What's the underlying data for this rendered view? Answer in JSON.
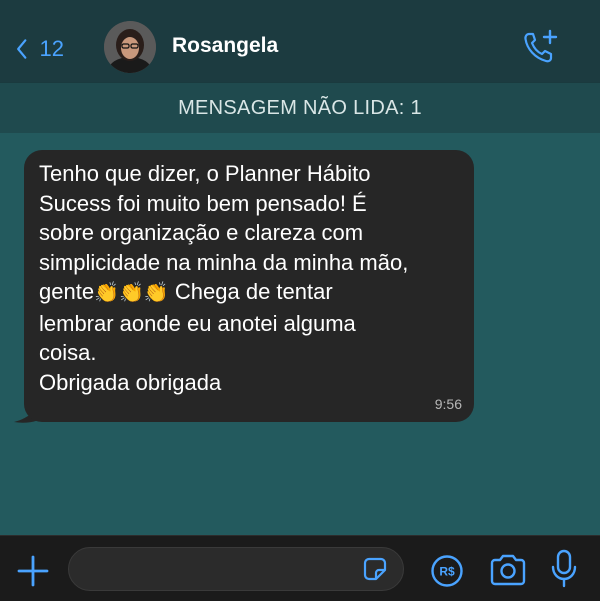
{
  "header": {
    "back_count": "12",
    "contact_name": "Rosangela"
  },
  "unread_banner": "MENSAGEM NÃO LIDA: 1",
  "message": {
    "lines": [
      "Tenho que dizer, o Planner Hábito",
      "Sucess foi muito bem pensado! É",
      "sobre organização e clareza com",
      "simplicidade na minha da minha mão,",
      "gente",
      "👏👏👏",
      " Chega de tentar",
      "lembrar aonde eu anotei alguma",
      "coisa.",
      "Obrigada obrigada"
    ],
    "time": "9:56"
  },
  "bottom_bar": {
    "pay_label": "R$"
  },
  "colors": {
    "accent": "#4aa3ff",
    "chat_background": "#235a5e",
    "header_background": "#1c3b40",
    "bubble": "#262626"
  },
  "icons": [
    "back-chevron-icon",
    "add-call-icon",
    "plus-icon",
    "sticker-icon",
    "payment-icon",
    "camera-icon",
    "microphone-icon"
  ]
}
